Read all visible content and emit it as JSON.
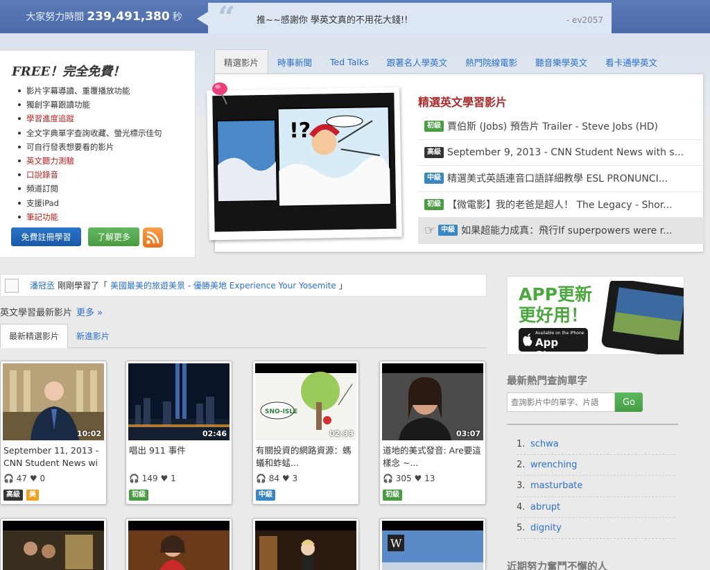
{
  "header": {
    "effort_label": "大家努力時間",
    "effort_count": "239,491,380",
    "effort_unit": "秒",
    "quote_text": "推~~感謝你 學英文真的不用花大錢!!",
    "quote_author": "- ev2057"
  },
  "free_panel": {
    "title": "FREE！完全免費！",
    "features": [
      "影片字幕導讀、重覆播放功能",
      "獨創字幕跟讀功能",
      "學習進度追蹤",
      "全文字典單字查詢收藏、螢光標示佳句",
      "可自行發表想要看的影片",
      "英文聽力測驗",
      "口說錄音",
      "頻道訂閱",
      "支援iPad",
      "筆記功能"
    ],
    "register_button": "免費註冊學習",
    "learn_more_button": "了解更多"
  },
  "main_tabs": [
    "精選影片",
    "時事新聞",
    "Ted Talks",
    "跟著名人學英文",
    "熱門院線電影",
    "聽音樂學英文",
    "看卡通學英文"
  ],
  "featured": {
    "title": "精選英文學習影片",
    "items": [
      {
        "level": "初級",
        "title": "賈伯斯 (Jobs) 預告片 Trailer - Steve Jobs (HD)"
      },
      {
        "level": "高級",
        "title": "September 9, 2013 - CNN Student News with s..."
      },
      {
        "level": "中級",
        "title": "精選美式英語連音口語詳細教學 ESL PRONUNCI..."
      },
      {
        "level": "初級",
        "title": "【微電影】我的老爸是超人！ The Legacy - Shor..."
      },
      {
        "level": "中級",
        "title": "如果超能力成真：飛行If superpowers were r..."
      }
    ]
  },
  "activity": {
    "user": "潘冠丞",
    "action": "剛剛學習了「",
    "video": "美國最美的旅遊美景 - 優勝美地 Experience Your Yosemite",
    "end": "」"
  },
  "latest": {
    "title": "英文學習最新影片",
    "more": "更多 »",
    "tabs": [
      "最新精選影片",
      "新進影片"
    ],
    "videos": [
      {
        "duration": "10:02",
        "title": "September 11, 2013 - CNN Student News wi",
        "listens": "47",
        "likes": "0",
        "badges": [
          "高級",
          "美"
        ]
      },
      {
        "duration": "02:46",
        "title": "唱出 911 事件",
        "listens": "149",
        "likes": "1",
        "badges": [
          "初級"
        ]
      },
      {
        "duration": "02:33",
        "title": "有關投資的網路資源：螞蟻和蚱蜢...",
        "listens": "84",
        "likes": "3",
        "badges": [
          "中級"
        ]
      },
      {
        "duration": "03:07",
        "title": "道地的美式發音: Are要這樣念 ~...",
        "listens": "305",
        "likes": "13",
        "badges": [
          "初級"
        ]
      }
    ]
  },
  "right": {
    "app_line1": "APP更新",
    "app_line2": "更好用！",
    "appstore_small": "Available on the iPhone",
    "appstore_big": "App Store",
    "words_title": "最新熱門查詢單字",
    "search_placeholder": "查詢影片中的單字、片語",
    "go": "Go",
    "words": [
      "schwa",
      "wrenching",
      "masturbate",
      "abrupt",
      "dignity"
    ],
    "recent_title": "近期努力奮鬥不懈的人"
  },
  "colors": {
    "accent": "#2a70c8",
    "header": "#4a6aa8",
    "red": "#a82b2b",
    "green": "#4a9c42"
  }
}
